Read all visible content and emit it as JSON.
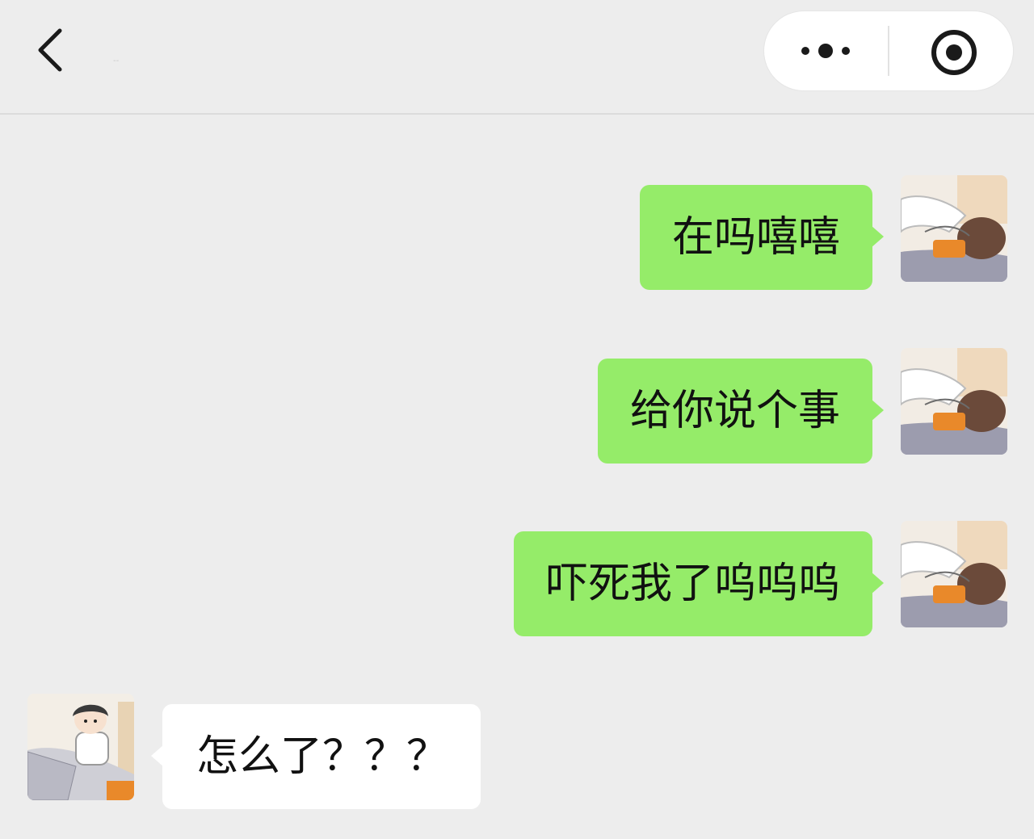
{
  "header": {
    "title": "--",
    "back_icon": "chevron-left-icon",
    "more_icon": "more-dots-icon",
    "close_icon": "target-circle-icon"
  },
  "colors": {
    "background": "#ededed",
    "sent_bubble": "#95ec69",
    "received_bubble": "#ffffff",
    "text": "#111111"
  },
  "messages": [
    {
      "direction": "sent",
      "text": "在吗嘻嘻"
    },
    {
      "direction": "sent",
      "text": "给你说个事"
    },
    {
      "direction": "sent",
      "text": "吓死我了呜呜呜"
    },
    {
      "direction": "received",
      "text": "怎么了？？？"
    }
  ]
}
